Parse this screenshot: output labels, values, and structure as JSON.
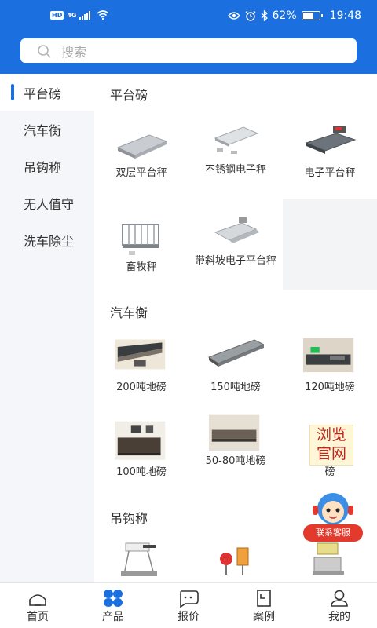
{
  "status_bar": {
    "hd": "HD",
    "network": "4G",
    "battery": "62%",
    "time": "19:48"
  },
  "search": {
    "placeholder": "搜索"
  },
  "sidebar": {
    "items": [
      {
        "label": "平台磅",
        "active": true
      },
      {
        "label": "汽车衡"
      },
      {
        "label": "吊钩称"
      },
      {
        "label": "无人值守"
      },
      {
        "label": "洗车除尘"
      }
    ]
  },
  "sections": [
    {
      "title": "平台磅",
      "products": [
        "双层平台秤",
        "不锈钢电子秤",
        "电子平台秤",
        "畜牧秤",
        "带斜坡电子平台秤"
      ]
    },
    {
      "title": "汽车衡",
      "products": [
        "200吨地磅",
        "150吨地磅",
        "120吨地磅",
        "100吨地磅",
        "50-80吨地磅",
        "磅"
      ]
    },
    {
      "title": "吊钩称",
      "products": []
    }
  ],
  "ad_badge": {
    "line1": "浏览",
    "line2": "官网"
  },
  "customer_service": {
    "label": "联系客服"
  },
  "bottom_nav": [
    {
      "label": "首页",
      "icon": "home-icon"
    },
    {
      "label": "产品",
      "icon": "product-grid-icon",
      "active": true
    },
    {
      "label": "报价",
      "icon": "quote-chat-icon"
    },
    {
      "label": "案例",
      "icon": "case-document-icon"
    },
    {
      "label": "我的",
      "icon": "user-profile-icon"
    }
  ],
  "colors": {
    "brand": "#1b6fde",
    "service_red": "#e23b2e"
  }
}
